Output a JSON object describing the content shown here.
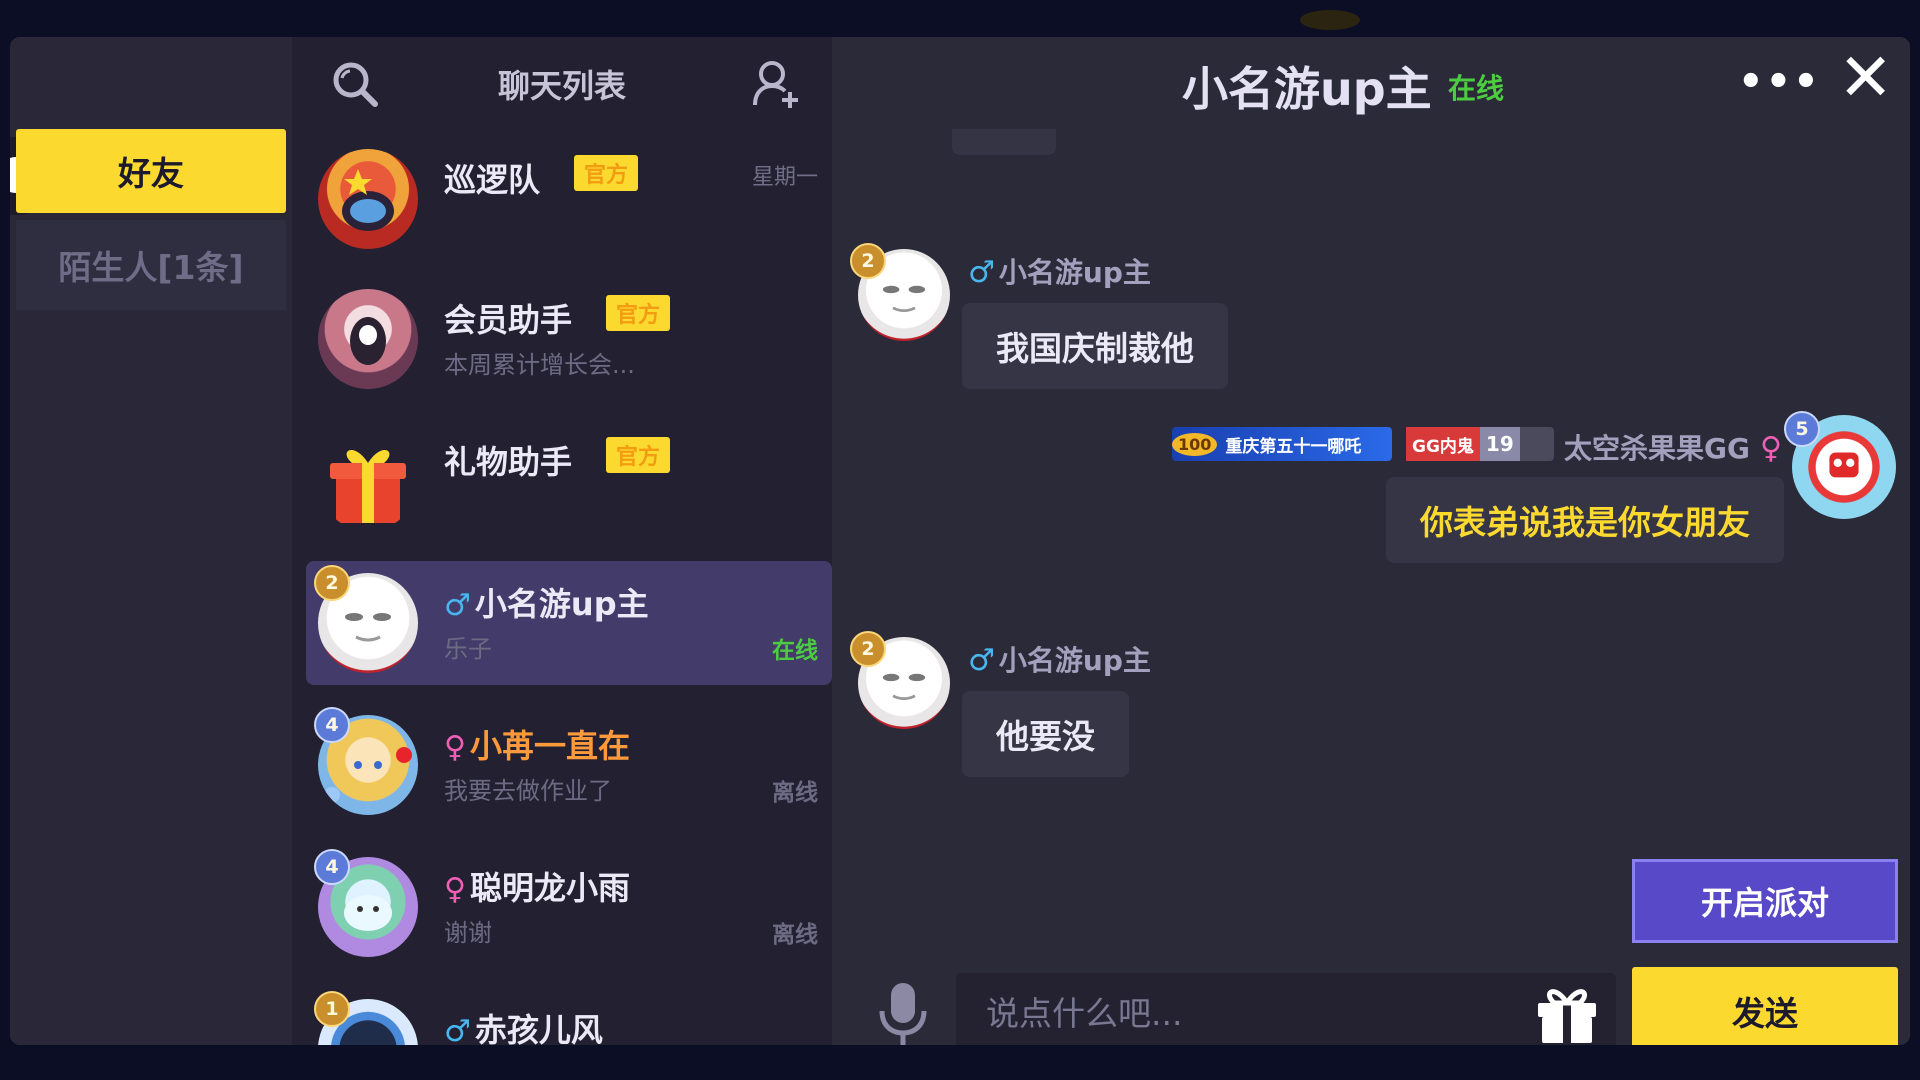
{
  "sidebar": {
    "tabs": [
      {
        "label": "好友",
        "selected": true
      },
      {
        "label": "陌生人[1条]",
        "selected": false
      }
    ]
  },
  "chat_list": {
    "title": "聊天列表",
    "icons": {
      "search": "search-icon",
      "add_friend": "add-friend-icon"
    },
    "items": [
      {
        "name": "巡逻队",
        "badge": "官方",
        "time": "星期一",
        "preview": "",
        "status": ""
      },
      {
        "name": "会员助手",
        "badge": "官方",
        "time": "",
        "preview": "本周累计增长会...",
        "status": ""
      },
      {
        "name": "礼物助手",
        "badge": "官方",
        "time": "",
        "preview": "",
        "status": ""
      },
      {
        "name": "小名游up主",
        "gender": "♂",
        "level": "2",
        "preview": "乐子",
        "status": "在线",
        "selected": true
      },
      {
        "name": "小苒一直在",
        "gender": "♀",
        "level": "4",
        "preview": "我要去做作业了",
        "status": "离线"
      },
      {
        "name": "聪明龙小雨",
        "gender": "♀",
        "level": "4",
        "preview": "谢谢",
        "status": "离线"
      },
      {
        "name": "赤孩儿风",
        "gender": "♂",
        "level": "1",
        "preview": "",
        "status": ""
      }
    ]
  },
  "chat": {
    "title": "小名游up主",
    "status": "在线",
    "more_label": "•••",
    "close_label": "✕",
    "messages": [
      {
        "sender": "小名游up主",
        "gender": "♂",
        "level": "2",
        "text": "我国庆制裁他",
        "mine": false
      },
      {
        "sender": "太空杀果果GG",
        "gender": "♀",
        "level": "5",
        "text": "你表弟说我是你女朋友",
        "mine": true,
        "tags": {
          "medal_number": "100",
          "medal_text": "重庆第五十一哪吒",
          "role_text": "GG内鬼",
          "role_level": "19"
        }
      },
      {
        "sender": "小名游up主",
        "gender": "♂",
        "level": "2",
        "text": "他要没",
        "mine": false
      }
    ],
    "composer": {
      "placeholder": "说点什么吧...",
      "party_label": "开启派对",
      "send_label": "发送",
      "icons": {
        "mic": "microphone-icon",
        "gift": "gift-icon"
      }
    }
  },
  "colors": {
    "accent_yellow": "#fbd92f",
    "online_green": "#4ccd3f",
    "party_purple": "#5849c9",
    "male_blue": "#49b7ef",
    "female_pink": "#ef5fb6"
  }
}
